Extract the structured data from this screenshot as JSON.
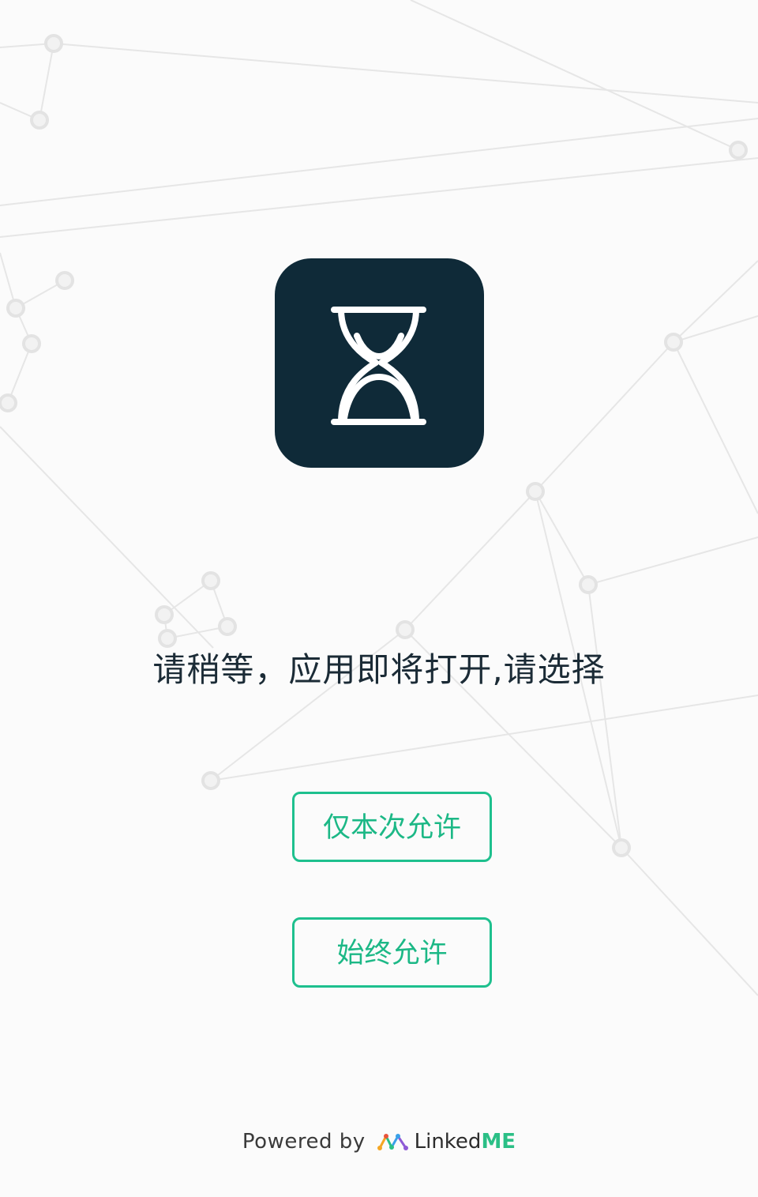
{
  "app_icon": {
    "icon": "hourglass-icon",
    "background_color": "#0f2a38",
    "stroke_color": "#ffffff"
  },
  "prompt": {
    "text": "请稍等，应用即将打开,请选择"
  },
  "buttons": {
    "allow_once_label": "仅本次允许",
    "allow_always_label": "始终允许",
    "accent_color": "#1ec08e"
  },
  "footer": {
    "powered_by": "Powered by",
    "brand_linked": "Linked",
    "brand_me": "ME",
    "brand_icon": "linkedme-logo-icon"
  }
}
